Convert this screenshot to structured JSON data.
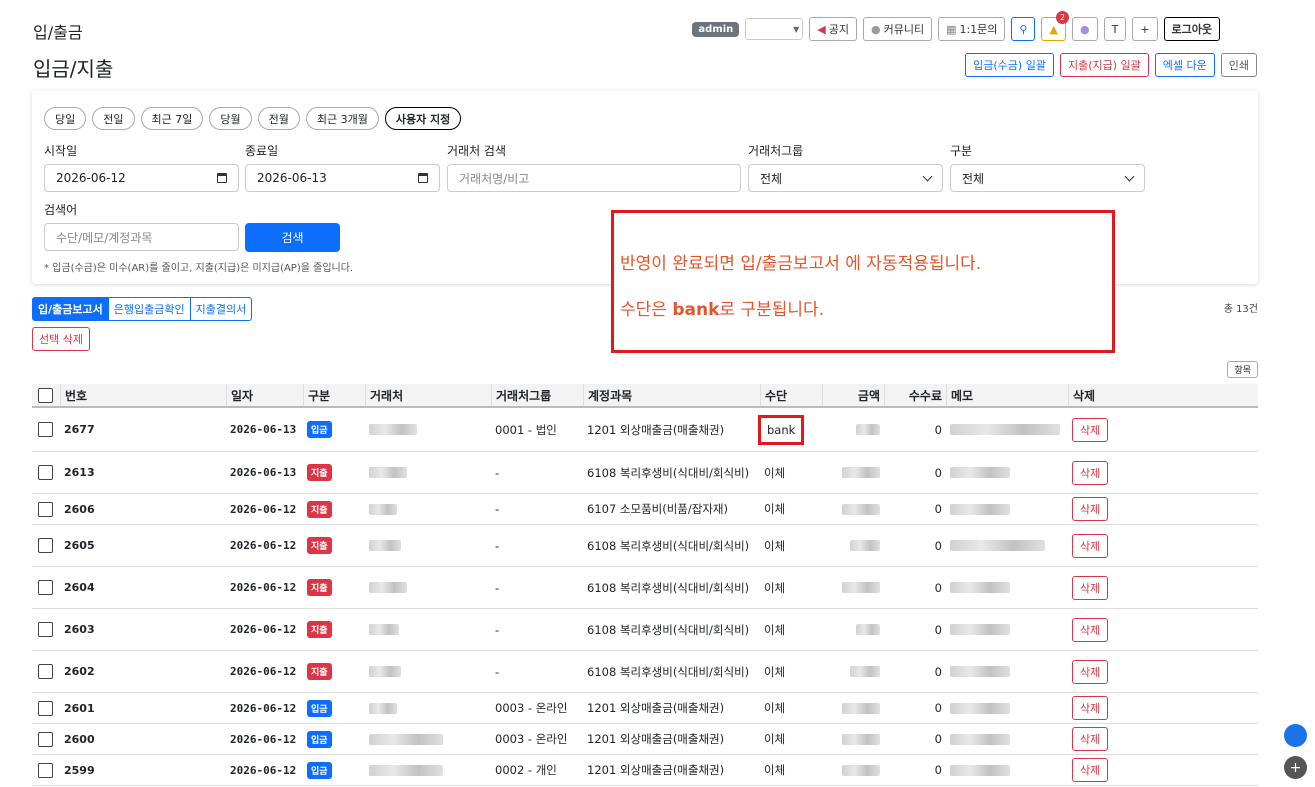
{
  "header": {
    "section_title": "입/출금",
    "page_title": "입금/지출",
    "admin_badge": "admin",
    "notify_count": "2"
  },
  "topbar": {
    "notice": "공지",
    "community": "커뮤니티",
    "inquiry": "1:1문의",
    "t": "T",
    "plus": "+",
    "logout": "로그아웃"
  },
  "actions": {
    "deposit_batch": "입금(수금) 일괄",
    "withdraw_batch": "지출(지급) 일괄",
    "excel": "엑셀 다운",
    "print": "인쇄"
  },
  "periods": [
    "당일",
    "전일",
    "최근 7일",
    "당월",
    "전월",
    "최근 3개월",
    "사용자 지정"
  ],
  "filters": {
    "start_label": "시작일",
    "start_value": "2026-06-12",
    "end_label": "종료일",
    "end_value": "2026-06-13",
    "partner_label": "거래처 검색",
    "partner_placeholder": "거래처명/비고",
    "group_label": "거래처그룹",
    "group_value": "전체",
    "kind_label": "구분",
    "kind_value": "전체",
    "keyword_label": "검색어",
    "keyword_placeholder": "수단/메모/계정과목",
    "search_btn": "검색",
    "note": "* 입금(수금)은 미수(AR)를 줄이고, 지출(지급)은 미지급(AP)을 줄입니다."
  },
  "tabs": [
    "입/출금보고서",
    "은행입출금확인",
    "지출결의서"
  ],
  "total": "총 13건",
  "select_delete": "선택 삭제",
  "callout": {
    "line1": "반영이 완료되면 입/출금보고서 에 자동적용됩니다.",
    "line2_pre": "수단은 ",
    "line2_bold": "bank",
    "line2_post": "로 구분됩니다."
  },
  "columns_btn": "항목",
  "table": {
    "headers": [
      "번호",
      "일자",
      "구분",
      "거래처",
      "거래처그룹",
      "계정과목",
      "수단",
      "금액",
      "수수료",
      "메모",
      "삭제"
    ],
    "rows": [
      {
        "no": "2677",
        "date": "2026-06-13",
        "kind": "입금",
        "group": "0001 - 법인",
        "acct": "1201 외상매출금(매출채권)",
        "method": "bank",
        "fee": "0",
        "del": "삭제"
      },
      {
        "no": "2613",
        "date": "2026-06-13",
        "kind": "지출",
        "group": "-",
        "acct": "6108 복리후생비(식대비/회식비)",
        "method": "이체",
        "fee": "0",
        "del": "삭제"
      },
      {
        "no": "2606",
        "date": "2026-06-12",
        "kind": "지출",
        "group": "-",
        "acct": "6107 소모품비(비품/잡자재)",
        "method": "이체",
        "fee": "0",
        "del": "삭제"
      },
      {
        "no": "2605",
        "date": "2026-06-12",
        "kind": "지출",
        "group": "-",
        "acct": "6108 복리후생비(식대비/회식비)",
        "method": "이체",
        "fee": "0",
        "del": "삭제"
      },
      {
        "no": "2604",
        "date": "2026-06-12",
        "kind": "지출",
        "group": "-",
        "acct": "6108 복리후생비(식대비/회식비)",
        "method": "이체",
        "fee": "0",
        "del": "삭제"
      },
      {
        "no": "2603",
        "date": "2026-06-12",
        "kind": "지출",
        "group": "-",
        "acct": "6108 복리후생비(식대비/회식비)",
        "method": "이체",
        "fee": "0",
        "del": "삭제"
      },
      {
        "no": "2602",
        "date": "2026-06-12",
        "kind": "지출",
        "group": "-",
        "acct": "6108 복리후생비(식대비/회식비)",
        "method": "이체",
        "fee": "0",
        "del": "삭제"
      },
      {
        "no": "2601",
        "date": "2026-06-12",
        "kind": "입금",
        "group": "0003 - 온라인",
        "acct": "1201 외상매출금(매출채권)",
        "method": "이체",
        "fee": "0",
        "del": "삭제"
      },
      {
        "no": "2600",
        "date": "2026-06-12",
        "kind": "입금",
        "group": "0003 - 온라인",
        "acct": "1201 외상매출금(매출채권)",
        "method": "이체",
        "fee": "0",
        "del": "삭제"
      },
      {
        "no": "2599",
        "date": "2026-06-12",
        "kind": "입금",
        "group": "0002 - 개인",
        "acct": "1201 외상매출금(매출채권)",
        "method": "이체",
        "fee": "0",
        "del": "삭제"
      }
    ]
  },
  "colors": {
    "primary": "#0d6efd",
    "danger": "#dc3545",
    "callout": "#e0191c"
  }
}
